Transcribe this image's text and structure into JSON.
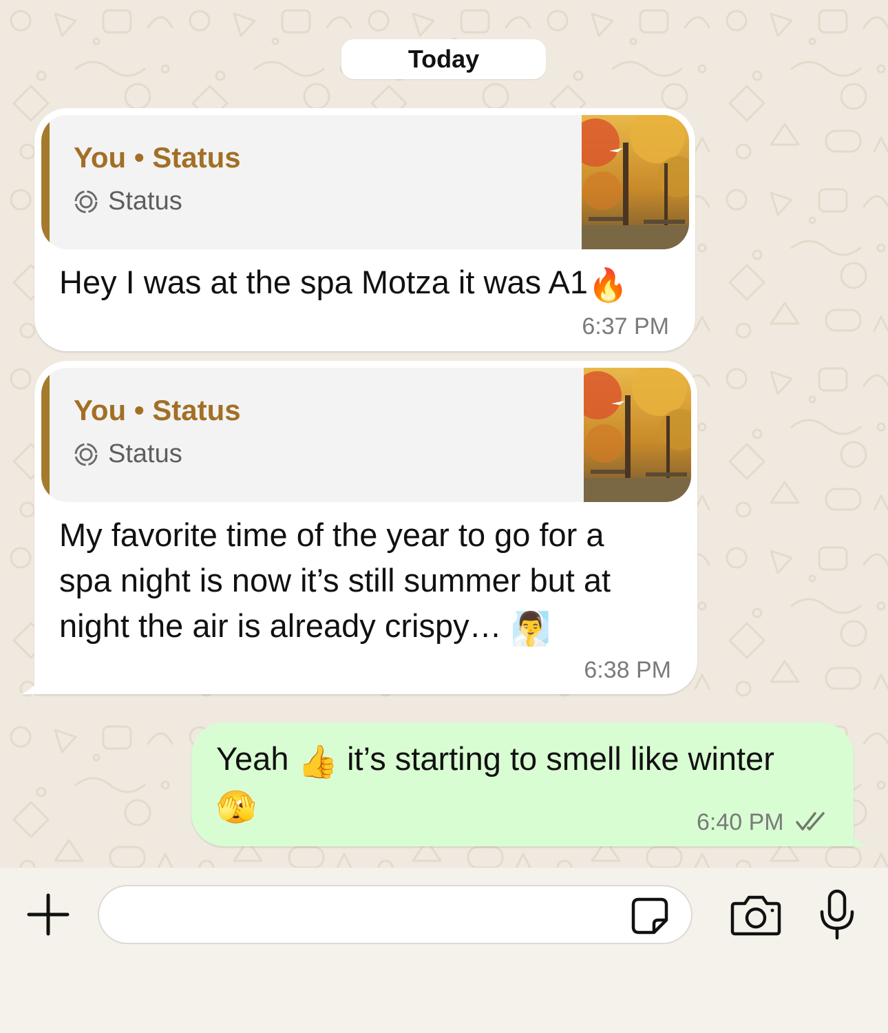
{
  "date_separator": "Today",
  "messages": [
    {
      "direction": "incoming",
      "quote": {
        "title": "You • Status",
        "subtitle": "Status",
        "subtitle_icon": "status-ring-icon",
        "thumbnail": "autumn-park-photo"
      },
      "text": "Hey I was at the spa Motza it was A1",
      "emoji": "🔥",
      "time": "6:37 PM"
    },
    {
      "direction": "incoming",
      "quote": {
        "title": "You • Status",
        "subtitle": "Status",
        "subtitle_icon": "status-ring-icon",
        "thumbnail": "autumn-park-photo"
      },
      "lines": [
        "My favorite time of the year to go for a",
        "spa night is now it’s still summer but at",
        "night the air is already crispy… "
      ],
      "emoji": "🧖‍♂️",
      "time": "6:38 PM"
    },
    {
      "direction": "outgoing",
      "text_before": "Yeah ",
      "emoji_1": "👍",
      "text_after": " it’s starting to smell like winter",
      "emoji_2": "🫣",
      "time": "6:40 PM",
      "status_icon": "double-check-icon",
      "status": "read"
    }
  ],
  "composer": {
    "placeholder": "",
    "attach_icon": "plus-icon",
    "sticker_icon": "sticker-icon",
    "camera_icon": "camera-icon",
    "mic_icon": "microphone-icon"
  },
  "colors": {
    "chat_background": "#efe9df",
    "incoming_bubble": "#ffffff",
    "outgoing_bubble": "#d9fdd3",
    "quote_accent": "#a57a2e",
    "quote_title": "#a26f25",
    "time_text": "#7a7a7a"
  }
}
